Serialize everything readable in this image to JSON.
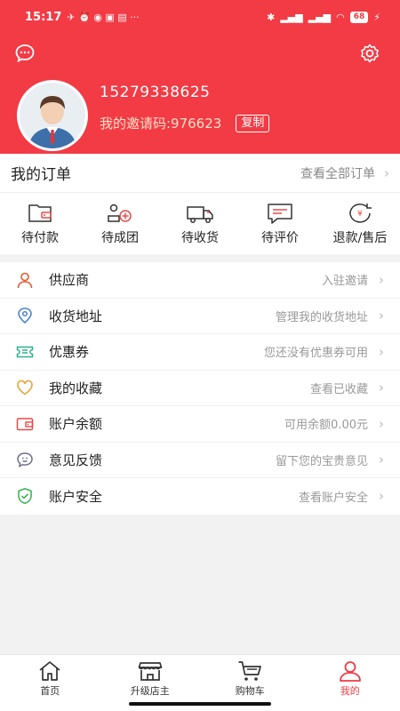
{
  "status_bar": {
    "time": "15:17",
    "battery": "68"
  },
  "profile": {
    "phone": "15279338625",
    "invite_code": "我的邀请码:976623",
    "copy_label": "复制"
  },
  "orders": {
    "title": "我的订单",
    "view_all": "查看全部订单",
    "items": [
      {
        "label": "待付款",
        "icon": "wallet-icon"
      },
      {
        "label": "待成团",
        "icon": "group-icon"
      },
      {
        "label": "待收货",
        "icon": "truck-icon"
      },
      {
        "label": "待评价",
        "icon": "comment-icon"
      },
      {
        "label": "退款/售后",
        "icon": "refund-icon"
      }
    ]
  },
  "menu": [
    {
      "label": "供应商",
      "hint": "入驻邀请",
      "icon": "supplier-icon",
      "color": "#e8582f"
    },
    {
      "label": "收货地址",
      "hint": "管理我的收货地址",
      "icon": "location-icon",
      "color": "#4a7fd6"
    },
    {
      "label": "优惠券",
      "hint": "您还没有优惠券可用",
      "icon": "coupon-icon",
      "color": "#2ab08d"
    },
    {
      "label": "我的收藏",
      "hint": "查看已收藏",
      "icon": "heart-icon",
      "color": "#e8a53a"
    },
    {
      "label": "账户余额",
      "hint": "可用余额0.00元",
      "icon": "wallet-balance-icon",
      "color": "#e84a4a"
    },
    {
      "label": "意见反馈",
      "hint": "留下您的宝贵意见",
      "icon": "feedback-icon",
      "color": "#6b6f8a"
    },
    {
      "label": "账户安全",
      "hint": "查看账户安全",
      "icon": "shield-icon",
      "color": "#2fb34a"
    }
  ],
  "tabbar": [
    {
      "label": "首页",
      "icon": "home-icon"
    },
    {
      "label": "升级店主",
      "icon": "store-icon"
    },
    {
      "label": "购物车",
      "icon": "cart-icon"
    },
    {
      "label": "我的",
      "icon": "user-icon",
      "active": true
    }
  ],
  "colors": {
    "brand": "#f23b45"
  }
}
